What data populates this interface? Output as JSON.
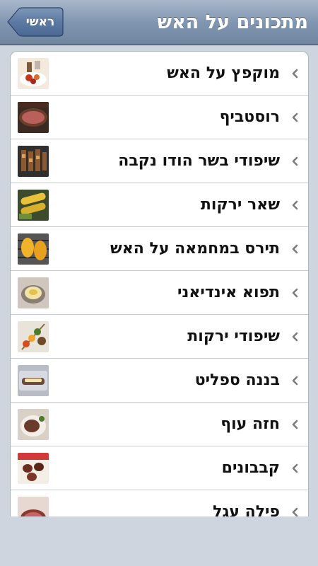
{
  "nav": {
    "title": "מתכונים על האש",
    "back_label": "ראשי"
  },
  "recipes": [
    {
      "label": "מוקפץ על האש",
      "thumb": "grilled-stir-fry-photo"
    },
    {
      "label": "רוסטביף",
      "thumb": "roast-beef-photo"
    },
    {
      "label": "שיפודי בשר הודו נקבה",
      "thumb": "turkey-skewers-photo"
    },
    {
      "label": "שאר ירקות",
      "thumb": "grilled-vegetables-photo"
    },
    {
      "label": "תירס במחמאה על האש",
      "thumb": "grilled-corn-photo"
    },
    {
      "label": "תפוא אינדיאני",
      "thumb": "baked-potato-photo"
    },
    {
      "label": "שיפודי ירקות",
      "thumb": "vegetable-skewers-photo"
    },
    {
      "label": "בננה ספליט",
      "thumb": "banana-split-photo"
    },
    {
      "label": "חזה עוף",
      "thumb": "chicken-breast-photo"
    },
    {
      "label": "קבבונים",
      "thumb": "kebabs-photo"
    },
    {
      "label": "פילה עגל",
      "thumb": "veal-fillet-photo"
    }
  ],
  "colors": {
    "nav_gradient_top": "#a9b8cb",
    "nav_gradient_bottom": "#70869f",
    "back_button": "#4f6b94",
    "background": "#cfd5de",
    "chevron": "#7b7b7b"
  }
}
